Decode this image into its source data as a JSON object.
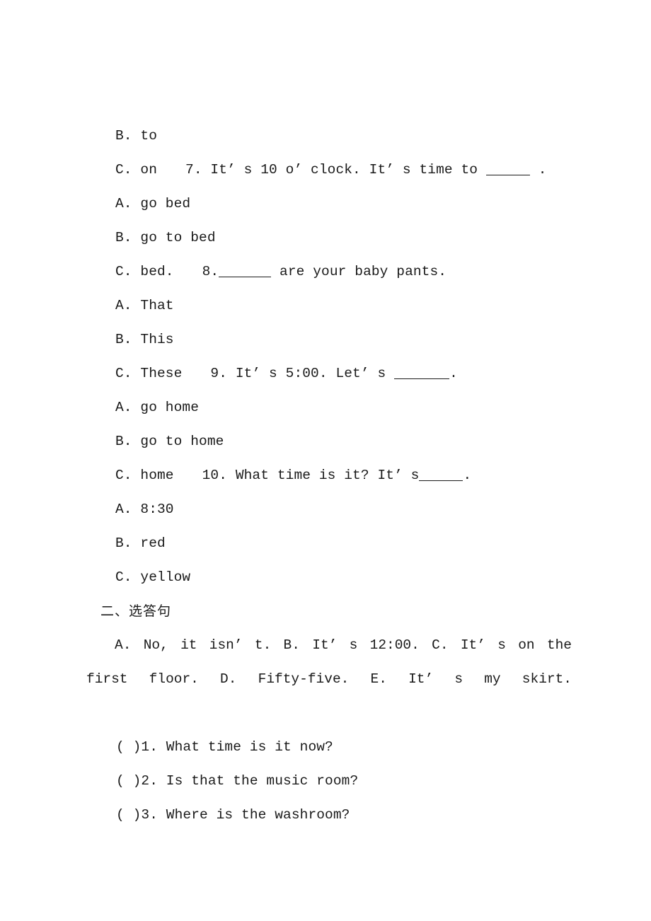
{
  "document": {
    "type": "worksheet-page",
    "background_color": "#ffffff",
    "text_color": "#1a1a1a"
  },
  "lines": {
    "l1_option_b_to": "B. to",
    "l2_option_c_on": "C. on",
    "l2_question7": "7. It’ s 10 o’ clock. It’ s time to",
    "l2_question7_tail": ".",
    "l3_option_a_gobed": "A. go bed",
    "l4_option_b_gotobed": "B. go to bed",
    "l5_option_c_bed": "C. bed.",
    "l5_question8_num": "8.",
    "l5_question8_tail": "are your baby pants.",
    "l6_option_a_that": "A. That",
    "l7_option_b_this": "B. This",
    "l8_option_c_these": "C. These",
    "l8_question9": "9. It’ s 5:00. Let’ s",
    "l8_question9_tail": ".",
    "l9_option_a_gohome": "A. go home",
    "l10_option_b_gotohome": "B. go to home",
    "l11_option_c_home": "C. home",
    "l11_question10": "10. What time is it? It’ s",
    "l11_question10_tail": ".",
    "l12_option_a_830": "A. 8:30",
    "l13_option_b_red": "B. red",
    "l14_option_c_yellow": "C. yellow",
    "section_two_heading": "二、选答句",
    "answer_bank": "A. No, it isn’ t. B. It’ s 12:00. C. It’ s on the first floor. D. Fifty-five. E. It’ s my skirt.",
    "match_item_1": "( )1. What time is it now?",
    "match_item_2": "( )2. Is that the music room?",
    "match_item_3": "( )3. Where is the washroom?"
  }
}
